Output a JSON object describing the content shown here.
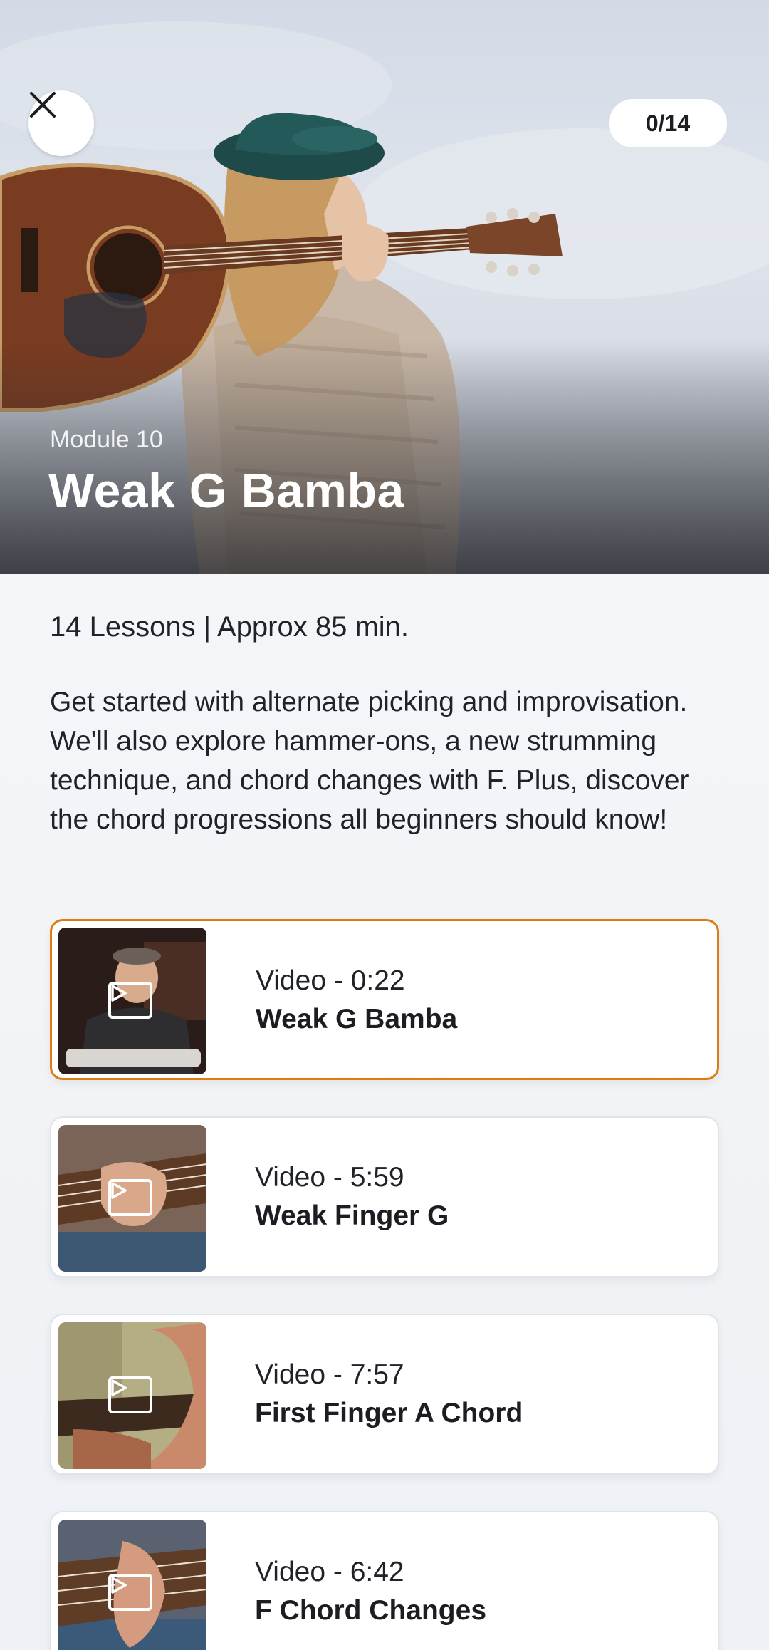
{
  "header": {
    "close_icon": "close-icon",
    "progress": "0/14",
    "module_label": "Module 10",
    "module_title": "Weak G Bamba"
  },
  "summary": {
    "meta": "14 Lessons | Approx 85 min.",
    "description": "Get started with alternate picking and improvisation. We'll also explore hammer-ons, a new strumming technique, and chord changes with F. Plus, discover the chord progressions all beginners should know!"
  },
  "lessons": [
    {
      "type": "Video - 0:22",
      "title": "Weak G Bamba",
      "active": true
    },
    {
      "type": "Video - 5:59",
      "title": "Weak Finger G",
      "active": false
    },
    {
      "type": "Video - 7:57",
      "title": "First Finger A Chord",
      "active": false
    },
    {
      "type": "Video - 6:42",
      "title": "F Chord Changes",
      "active": false
    }
  ],
  "colors": {
    "accent": "#e07b12",
    "text": "#1b1d22",
    "background": "#f3f5f8"
  }
}
